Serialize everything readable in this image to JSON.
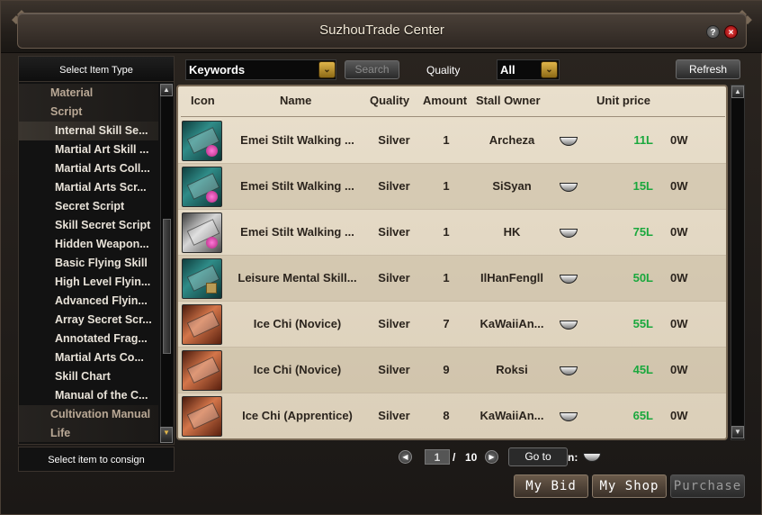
{
  "window": {
    "title": "SuzhouTrade Center"
  },
  "left_panel": {
    "header": "Select Item Type",
    "footer": "Select item to consign",
    "categories": [
      {
        "label": "Material",
        "level": "top"
      },
      {
        "label": "Script",
        "level": "top"
      },
      {
        "label": "Internal Skill Se...",
        "level": "sub",
        "selected": true
      },
      {
        "label": "Martial Art Skill ...",
        "level": "sub"
      },
      {
        "label": "Martial Arts Coll...",
        "level": "sub"
      },
      {
        "label": "Martial Arts Scr...",
        "level": "sub"
      },
      {
        "label": "Secret Script",
        "level": "sub"
      },
      {
        "label": "Skill Secret Script",
        "level": "sub"
      },
      {
        "label": "Hidden Weapon...",
        "level": "sub"
      },
      {
        "label": "Basic Flying Skill",
        "level": "sub"
      },
      {
        "label": "High Level Flyin...",
        "level": "sub"
      },
      {
        "label": "Advanced Flyin...",
        "level": "sub"
      },
      {
        "label": "Array Secret Scr...",
        "level": "sub"
      },
      {
        "label": "Annotated Frag...",
        "level": "sub"
      },
      {
        "label": "Martial Arts Co...",
        "level": "sub"
      },
      {
        "label": "Skill Chart",
        "level": "sub"
      },
      {
        "label": "Manual of the C...",
        "level": "sub"
      },
      {
        "label": "Cultivation Manual",
        "level": "top"
      },
      {
        "label": "Life",
        "level": "top"
      }
    ]
  },
  "filters": {
    "keywords_value": "Keywords",
    "search_label": "Search",
    "quality_label": "Quality",
    "quality_value": "All",
    "refresh_label": "Refresh"
  },
  "table": {
    "headers": {
      "icon": "Icon",
      "name": "Name",
      "quality": "Quality",
      "amount": "Amount",
      "owner": "Stall Owner",
      "price": "Unit price"
    },
    "rows": [
      {
        "icon": "green-skill-book-icon",
        "name": "Emei Stilt Walking ...",
        "quality": "Silver",
        "amount": "1",
        "owner": "Archeza",
        "price": "11L",
        "price2": "0W"
      },
      {
        "icon": "green-skill-book-icon",
        "name": "Emei Stilt Walking ...",
        "quality": "Silver",
        "amount": "1",
        "owner": "SiSyan",
        "price": "15L",
        "price2": "0W"
      },
      {
        "icon": "white-skill-book-icon",
        "name": "Emei Stilt Walking ...",
        "quality": "Silver",
        "amount": "1",
        "owner": "HK",
        "price": "75L",
        "price2": "0W"
      },
      {
        "icon": "green-scroll-book-icon",
        "name": "Leisure Mental Skill...",
        "quality": "Silver",
        "amount": "1",
        "owner": "IlHanFengll",
        "price": "50L",
        "price2": "0W"
      },
      {
        "icon": "red-book-icon",
        "name": "Ice Chi (Novice)",
        "quality": "Silver",
        "amount": "7",
        "owner": "KaWaiiAn...",
        "price": "55L",
        "price2": "0W"
      },
      {
        "icon": "red-book-icon",
        "name": "Ice Chi (Novice)",
        "quality": "Silver",
        "amount": "9",
        "owner": "Roksi",
        "price": "45L",
        "price2": "0W"
      },
      {
        "icon": "red-book-icon",
        "name": "Ice Chi (Apprentice)",
        "quality": "Silver",
        "amount": "8",
        "owner": "KaWaiiAn...",
        "price": "65L",
        "price2": "0W"
      }
    ]
  },
  "pager": {
    "current_page": "1",
    "separator": "/",
    "total_pages": "10",
    "goto_label": "Go to",
    "suffix": "n:"
  },
  "bottom_buttons": {
    "my_bid": "My Bid",
    "my_shop": "My Shop",
    "purchase": "Purchase"
  },
  "colors": {
    "price_green": "#1aa83d",
    "table_bg": "#e9dfcc",
    "accent_gold": "#e0b54a"
  }
}
